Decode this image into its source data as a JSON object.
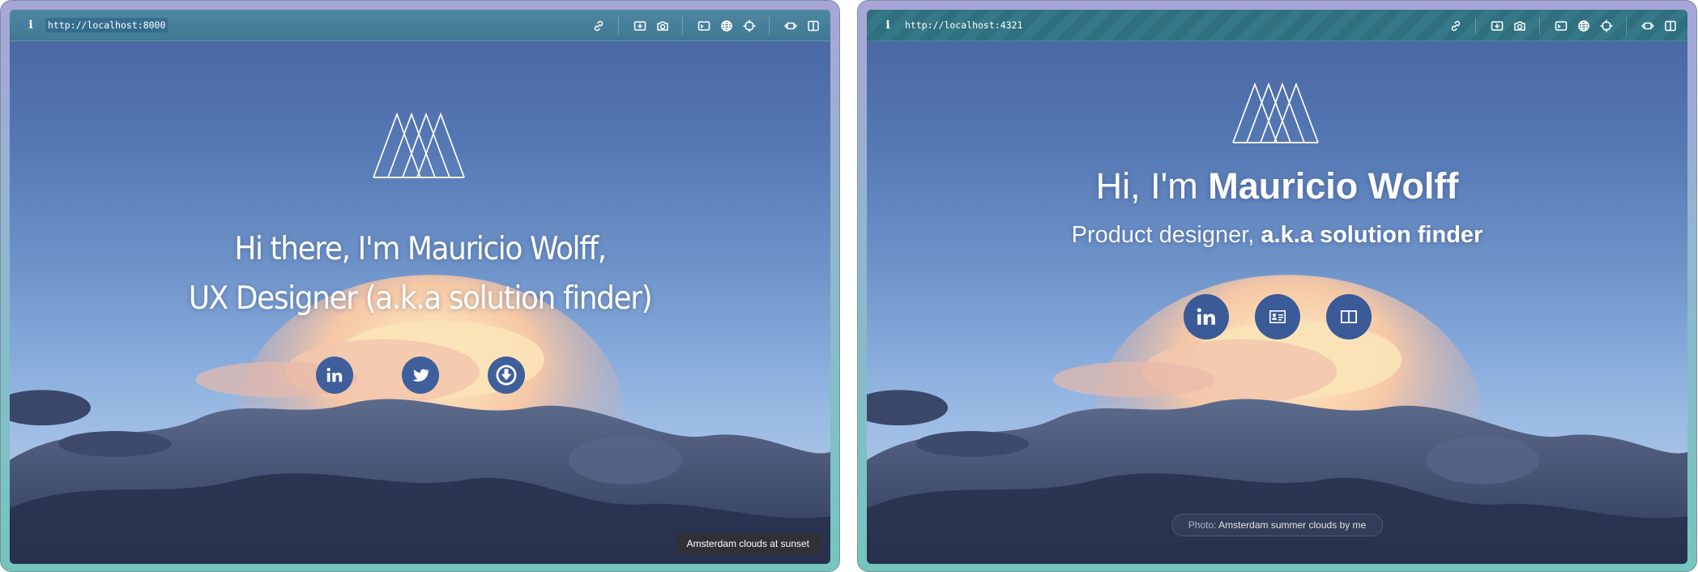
{
  "left_window": {
    "url": "http://localhost:8000",
    "headline_line1": "Hi there, I'm Mauricio Wolff,",
    "headline_line2": "UX Designer (a.k.a solution finder)",
    "social_icons": [
      "linkedin-icon",
      "twitter-icon",
      "download-icon"
    ],
    "caption": "Amsterdam clouds at sunset"
  },
  "right_window": {
    "url": "http://localhost:4321",
    "greeting": "Hi, I'm",
    "name": "Mauricio Wolff",
    "role_light": "Product designer,",
    "role_bold": "a.k.a solution finder",
    "social_icons": [
      "linkedin-icon",
      "id-card-icon",
      "book-icon"
    ],
    "caption_prefix": "Photo:",
    "caption_text": "Amsterdam summer clouds by me"
  },
  "toolbar_icons": [
    "info-icon",
    "link-icon",
    "screenshot-icon",
    "camera-icon",
    "console-icon",
    "globe-icon",
    "crosshair-icon",
    "responsive-icon",
    "sidebar-icon"
  ],
  "colors": {
    "frame_gradient_top": "#a8a6d8",
    "frame_gradient_bottom": "#74c6bd",
    "toolbar_left": "#4480a0",
    "toolbar_right": "#2f6f7e",
    "sky_top": "#4a68a4",
    "sky_bottom": "#a9c4e3",
    "social_left": "#3f5f9c",
    "social_right": "#3a5a98"
  }
}
